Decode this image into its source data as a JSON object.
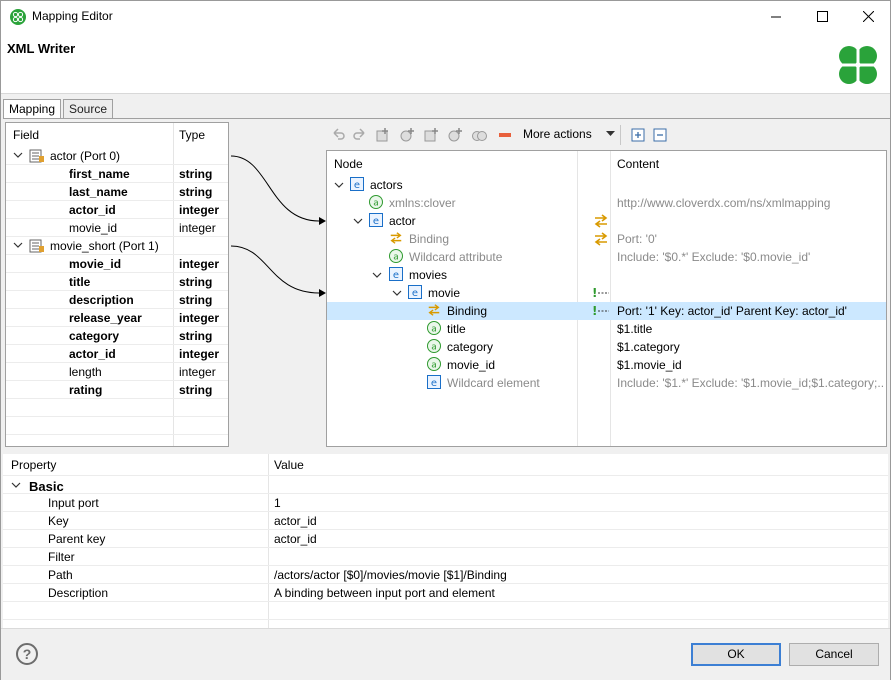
{
  "window": {
    "title": "Mapping Editor"
  },
  "header": {
    "title": "XML Writer"
  },
  "tabs": [
    {
      "label": "Mapping"
    },
    {
      "label": "Source"
    }
  ],
  "fields": {
    "columns": {
      "field": "Field",
      "type": "Type"
    },
    "ports": [
      {
        "label": "actor (Port 0)"
      },
      {
        "label": "movie_short (Port 1)"
      }
    ],
    "rows0": [
      {
        "name": "first_name",
        "type": "string"
      },
      {
        "name": "last_name",
        "type": "string"
      },
      {
        "name": "actor_id",
        "type": "integer"
      },
      {
        "name": "movie_id",
        "type": "integer"
      }
    ],
    "rows1": [
      {
        "name": "movie_id",
        "type": "integer"
      },
      {
        "name": "title",
        "type": "string"
      },
      {
        "name": "description",
        "type": "string"
      },
      {
        "name": "release_year",
        "type": "integer"
      },
      {
        "name": "category",
        "type": "string"
      },
      {
        "name": "actor_id",
        "type": "integer"
      },
      {
        "name": "length",
        "type": "integer"
      },
      {
        "name": "rating",
        "type": "string"
      }
    ]
  },
  "toolbar": {
    "more_actions": "More actions"
  },
  "tree": {
    "columns": {
      "node": "Node",
      "content": "Content"
    },
    "rows": [
      {
        "label": "actors",
        "content": ""
      },
      {
        "label": "xmlns:clover",
        "content": "http://www.cloverdx.com/ns/xmlmapping"
      },
      {
        "label": "actor",
        "content": ""
      },
      {
        "label": "Binding",
        "content": "Port: '0'"
      },
      {
        "label": "Wildcard attribute",
        "content": "Include: '$0.*' Exclude: '$0.movie_id'"
      },
      {
        "label": "movies",
        "content": ""
      },
      {
        "label": "movie",
        "content": ""
      },
      {
        "label": "Binding",
        "content": "Port: '1' Key: actor_id' Parent Key: actor_id'"
      },
      {
        "label": "title",
        "content": "$1.title"
      },
      {
        "label": "category",
        "content": "$1.category"
      },
      {
        "label": "movie_id",
        "content": "$1.movie_id"
      },
      {
        "label": "Wildcard element",
        "content": "Include: '$1.*' Exclude: '$1.movie_id;$1.category;..."
      }
    ]
  },
  "properties": {
    "columns": {
      "property": "Property",
      "value": "Value"
    },
    "group": "Basic",
    "rows": [
      {
        "name": "Input port",
        "value": "1"
      },
      {
        "name": "Key",
        "value": "actor_id"
      },
      {
        "name": "Parent key",
        "value": "actor_id"
      },
      {
        "name": "Filter",
        "value": ""
      },
      {
        "name": "Path",
        "value": "/actors/actor [$0]/movies/movie [$1]/Binding"
      },
      {
        "name": "Description",
        "value": "A binding between input port and element"
      }
    ]
  },
  "buttons": {
    "ok": "OK",
    "cancel": "Cancel",
    "help": "?"
  },
  "colors": {
    "accent": "#2aa33a",
    "selection": "#cce8ff",
    "element_icon": "#1a6fc8",
    "attribute_icon": "#2f9a2f",
    "binding_icon": "#d99a00"
  }
}
